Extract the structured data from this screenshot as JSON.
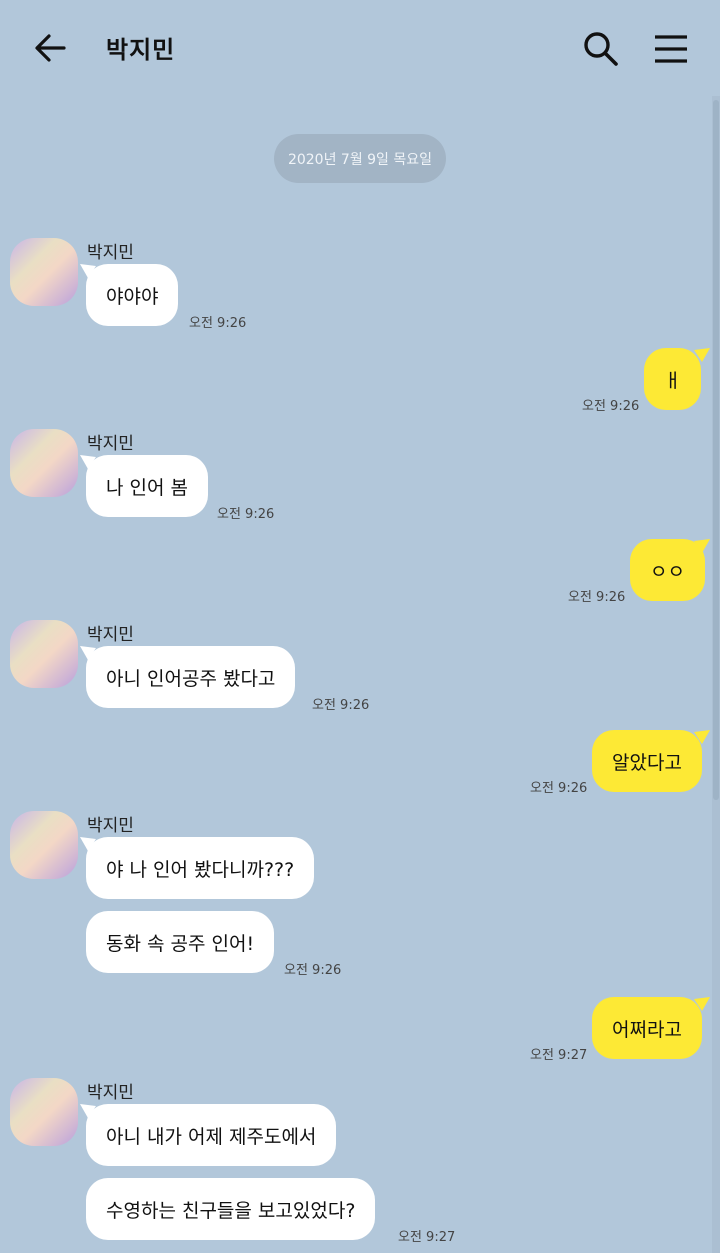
{
  "header": {
    "title": "박지민",
    "back_icon": "arrow-left-icon",
    "search_icon": "search-icon",
    "menu_icon": "hamburger-menu-icon"
  },
  "date_divider": "2020년 7월 9일 목요일",
  "colors": {
    "background": "#b2c7da",
    "incoming_bubble": "#ffffff",
    "outgoing_bubble": "#fde935",
    "date_pill": "#a2b4c5"
  },
  "messages": [
    {
      "from": "박지민",
      "text": "야야야",
      "time": "오전 9:26"
    },
    {
      "from": "me",
      "text": "ㅐ",
      "time": "오전 9:26"
    },
    {
      "from": "박지민",
      "text": "나 인어 봄",
      "time": "오전 9:26"
    },
    {
      "from": "me",
      "text": "ㅇㅇ",
      "time": "오전 9:26"
    },
    {
      "from": "박지민",
      "text": "아니 인어공주 봤다고",
      "time": "오전 9:26"
    },
    {
      "from": "me",
      "text": "알았다고",
      "time": "오전 9:26"
    },
    {
      "from": "박지민",
      "text": "야 나 인어 봤다니까???",
      "time": ""
    },
    {
      "from": "박지민",
      "text": "동화 속 공주 인어!",
      "time": "오전 9:26"
    },
    {
      "from": "me",
      "text": "어쩌라고",
      "time": "오전 9:27"
    },
    {
      "from": "박지민",
      "text": "아니 내가 어제 제주도에서",
      "time": ""
    },
    {
      "from": "박지민",
      "text": "수영하는 친구들을 보고있었다?",
      "time": "오전 9:27"
    }
  ]
}
